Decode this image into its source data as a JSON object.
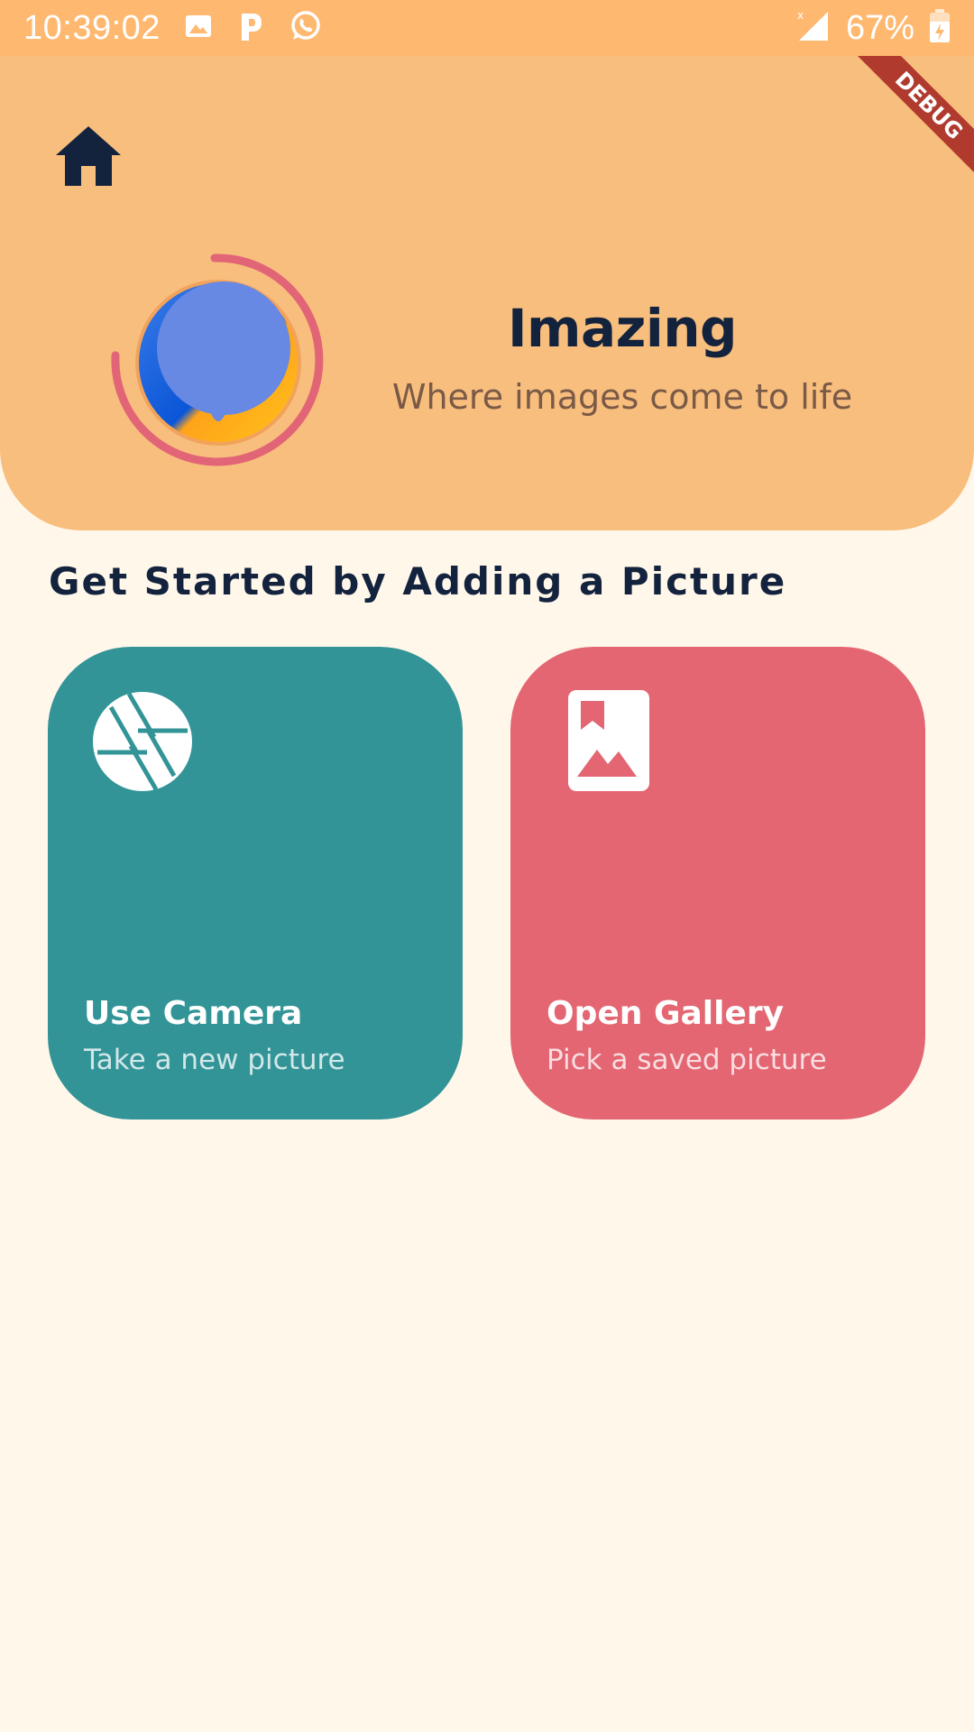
{
  "status_bar": {
    "time": "10:39:02",
    "left_icons": [
      "image-icon",
      "parking-app-icon",
      "whatsapp-icon"
    ],
    "signal_icon": "signal-icon",
    "battery_percent": "67%",
    "battery_icon": "battery-charging-icon"
  },
  "header": {
    "home_icon": "home-icon",
    "logo_icon": "app-logo-icon",
    "title": "Imazing",
    "subtitle": "Where images come to life",
    "debug_label": "DEBUG"
  },
  "main": {
    "section_title": "Get Started by Adding a Picture",
    "cards": [
      {
        "title": "Use Camera",
        "subtitle": "Take a new picture",
        "icon": "camera-aperture-icon",
        "color": "#329497"
      },
      {
        "title": "Open Gallery",
        "subtitle": "Pick a saved picture",
        "icon": "photo-album-icon",
        "color": "#E36672"
      }
    ]
  },
  "colors": {
    "status_bar": "#FFB870",
    "header_bg": "#F8BE7D",
    "page_bg": "#FFF7EA",
    "title": "#13223D",
    "subtitle": "#7A5A47"
  }
}
